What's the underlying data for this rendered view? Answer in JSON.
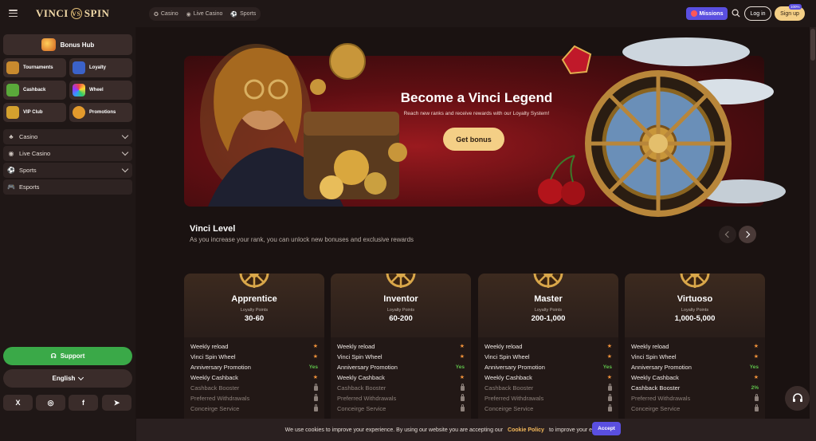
{
  "brand": {
    "logo_left": "VINCI",
    "logo_mark": "VS",
    "logo_right": "SPIN"
  },
  "topnav": [
    {
      "label": "Casino",
      "icon": "casino-chip-icon"
    },
    {
      "label": "Live Casino",
      "icon": "live-broadcast-icon"
    },
    {
      "label": "Sports",
      "icon": "soccer-ball-icon"
    }
  ],
  "header": {
    "missions": "Missions",
    "login": "Log in",
    "signup": "Sign up",
    "signup_badge": "100%"
  },
  "sidebar": {
    "bonus_hub": "Bonus Hub",
    "tiles": [
      {
        "label": "Tournaments",
        "icon": "trophy-icon",
        "color": "#c98a2e"
      },
      {
        "label": "Loyalty",
        "icon": "shield-icon",
        "color": "#3b62c9"
      },
      {
        "label": "Cashback",
        "icon": "cash-icon",
        "color": "#5aa93a"
      },
      {
        "label": "Wheel",
        "icon": "wheel-icon",
        "color": "#9b3fbf"
      },
      {
        "label": "VIP Club",
        "icon": "crown-icon",
        "color": "#d4a12e"
      },
      {
        "label": "Promotions",
        "icon": "percent-icon",
        "color": "#e39a2c"
      }
    ],
    "nav": [
      {
        "label": "Casino",
        "icon": "♣",
        "chevron": true
      },
      {
        "label": "Live Casino",
        "icon": "◉",
        "chevron": true
      },
      {
        "label": "Sports",
        "icon": "⚽",
        "chevron": true
      },
      {
        "label": "Esports",
        "icon": "🎮",
        "chevron": false
      }
    ],
    "support": "Support",
    "language": "English",
    "socials": [
      "X",
      "◎",
      "f",
      "➤"
    ]
  },
  "banner": {
    "title": "Become a Vinci Legend",
    "subtitle": "Reach new ranks and receive rewards with our Loyalty System!",
    "cta": "Get bonus"
  },
  "levels": {
    "title": "Vinci Level",
    "subtitle": "As you increase your rank, you can unlock new bonuses and exclusive rewards",
    "loyalty_label": "Loyalty Points",
    "cards": [
      {
        "name": "Apprentice",
        "range": "30-60",
        "perks": [
          {
            "name": "Weekly reload",
            "value": "star",
            "on": true
          },
          {
            "name": "Vinci Spin Wheel",
            "value": "star",
            "on": true
          },
          {
            "name": "Anniversary Promotion",
            "value": "Yes",
            "on": true
          },
          {
            "name": "Weekly Cashback",
            "value": "star",
            "on": true
          },
          {
            "name": "Cashback Booster",
            "value": "lock",
            "on": false
          },
          {
            "name": "Preferred Withdrawals",
            "value": "lock",
            "on": false
          },
          {
            "name": "Conceirge Service",
            "value": "lock",
            "on": false
          }
        ]
      },
      {
        "name": "Inventor",
        "range": "60-200",
        "perks": [
          {
            "name": "Weekly reload",
            "value": "star",
            "on": true
          },
          {
            "name": "Vinci Spin Wheel",
            "value": "star",
            "on": true
          },
          {
            "name": "Anniversary Promotion",
            "value": "Yes",
            "on": true
          },
          {
            "name": "Weekly Cashback",
            "value": "star",
            "on": true
          },
          {
            "name": "Cashback Booster",
            "value": "lock",
            "on": false
          },
          {
            "name": "Preferred Withdrawals",
            "value": "lock",
            "on": false
          },
          {
            "name": "Conceirge Service",
            "value": "lock",
            "on": false
          }
        ]
      },
      {
        "name": "Master",
        "range": "200-1,000",
        "perks": [
          {
            "name": "Weekly reload",
            "value": "star",
            "on": true
          },
          {
            "name": "Vinci Spin Wheel",
            "value": "star",
            "on": true
          },
          {
            "name": "Anniversary Promotion",
            "value": "Yes",
            "on": true
          },
          {
            "name": "Weekly Cashback",
            "value": "star",
            "on": true
          },
          {
            "name": "Cashback Booster",
            "value": "lock",
            "on": false
          },
          {
            "name": "Preferred Withdrawals",
            "value": "lock",
            "on": false
          },
          {
            "name": "Conceirge Service",
            "value": "lock",
            "on": false
          }
        ]
      },
      {
        "name": "Virtuoso",
        "range": "1,000-5,000",
        "perks": [
          {
            "name": "Weekly reload",
            "value": "star",
            "on": true
          },
          {
            "name": "Vinci Spin Wheel",
            "value": "star",
            "on": true
          },
          {
            "name": "Anniversary Promotion",
            "value": "Yes",
            "on": true
          },
          {
            "name": "Weekly Cashback",
            "value": "star",
            "on": true
          },
          {
            "name": "Cashback Booster",
            "value": "2%",
            "on": true
          },
          {
            "name": "Preferred Withdrawals",
            "value": "lock",
            "on": false
          },
          {
            "name": "Conceirge Service",
            "value": "lock",
            "on": false
          }
        ]
      }
    ]
  },
  "cookie": {
    "text_before": "We use cookies to improve your experience. By using our website you are accepting our",
    "link": "Cookie Policy",
    "text_after": "to improve your experience",
    "accept": "Accept"
  },
  "colors": {
    "accent": "#f4cf86",
    "missions": "#5a4fe0",
    "support": "#3aa948",
    "star": "#f0913a",
    "yes": "#5ec14a"
  }
}
